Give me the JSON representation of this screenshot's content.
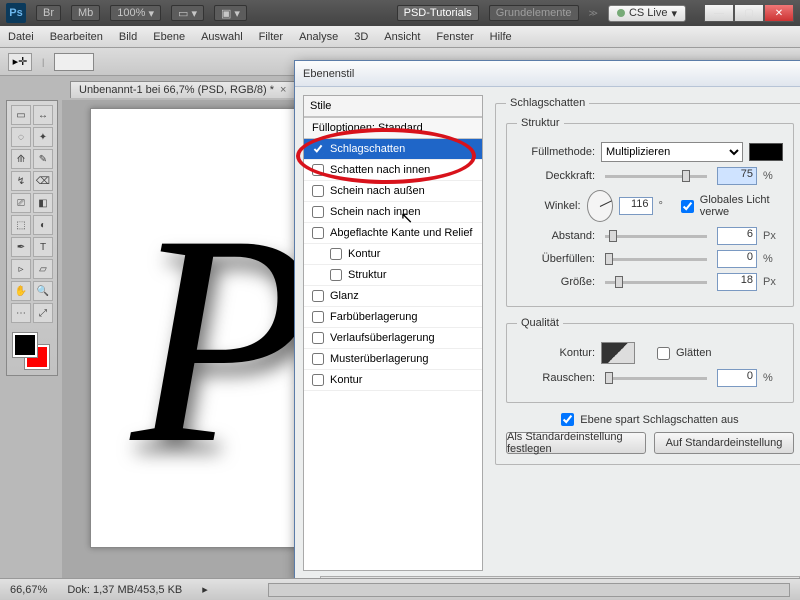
{
  "titlebar": {
    "app_short": "Ps",
    "chips": [
      "Br",
      "Mb"
    ],
    "zoom": "100%",
    "workspace_dropdown": "PSD-Tutorials",
    "workspace_secondary": "Grundelemente",
    "cslive": "CS Live"
  },
  "menubar": [
    "Datei",
    "Bearbeiten",
    "Bild",
    "Ebene",
    "Auswahl",
    "Filter",
    "Analyse",
    "3D",
    "Ansicht",
    "Fenster",
    "Hilfe"
  ],
  "doc_tab": {
    "title": "Unbenannt-1 bei 66,7% (PSD, RGB/8) *"
  },
  "canvas": {
    "glyph": "P"
  },
  "statusbar": {
    "zoom": "66,67%",
    "docinfo": "Dok: 1,37 MB/453,5 KB"
  },
  "dialog": {
    "title": "Ebenenstil",
    "styles_header": "Stile",
    "fill_opts": "Fülloptionen: Standard",
    "styles": [
      {
        "label": "Schlagschatten",
        "checked": true,
        "selected": true,
        "indent": false
      },
      {
        "label": "Schatten nach innen",
        "checked": false,
        "selected": false,
        "indent": false
      },
      {
        "label": "Schein nach außen",
        "checked": false,
        "selected": false,
        "indent": false
      },
      {
        "label": "Schein nach innen",
        "checked": false,
        "selected": false,
        "indent": false
      },
      {
        "label": "Abgeflachte Kante und Relief",
        "checked": false,
        "selected": false,
        "indent": false
      },
      {
        "label": "Kontur",
        "checked": false,
        "selected": false,
        "indent": true
      },
      {
        "label": "Struktur",
        "checked": false,
        "selected": false,
        "indent": true
      },
      {
        "label": "Glanz",
        "checked": false,
        "selected": false,
        "indent": false
      },
      {
        "label": "Farbüberlagerung",
        "checked": false,
        "selected": false,
        "indent": false
      },
      {
        "label": "Verlaufsüberlagerung",
        "checked": false,
        "selected": false,
        "indent": false
      },
      {
        "label": "Musterüberlagerung",
        "checked": false,
        "selected": false,
        "indent": false
      },
      {
        "label": "Kontur",
        "checked": false,
        "selected": false,
        "indent": false
      }
    ],
    "group_title": "Schlagschatten",
    "struct_title": "Struktur",
    "quality_title": "Qualität",
    "labels": {
      "blendmode": "Füllmethode:",
      "opacity": "Deckkraft:",
      "angle": "Winkel:",
      "global": "Globales Licht verwe",
      "distance": "Abstand:",
      "spread": "Überfüllen:",
      "size": "Größe:",
      "contour": "Kontur:",
      "antialias": "Glätten",
      "noise": "Rauschen:",
      "knockout": "Ebene spart Schlagschatten aus",
      "make_default": "Als Standardeinstellung festlegen",
      "reset_default": "Auf Standardeinstellung"
    },
    "values": {
      "blendmode": "Multiplizieren",
      "opacity": "75",
      "angle": "116",
      "global_checked": true,
      "distance": "6",
      "spread": "0",
      "size": "18",
      "noise": "0",
      "knockout_checked": true,
      "unit_pct": "%",
      "unit_deg": "°",
      "unit_px": "Px"
    }
  },
  "toolbox_icons": [
    "▭",
    "↔",
    "◌",
    "✦",
    "⟰",
    "✎",
    "↯",
    "⌫",
    "⎚",
    "◧",
    "⬚",
    "◐",
    "✒",
    "T",
    "▹",
    "▱",
    "✋",
    "🔍",
    "⋯",
    "⤢"
  ]
}
